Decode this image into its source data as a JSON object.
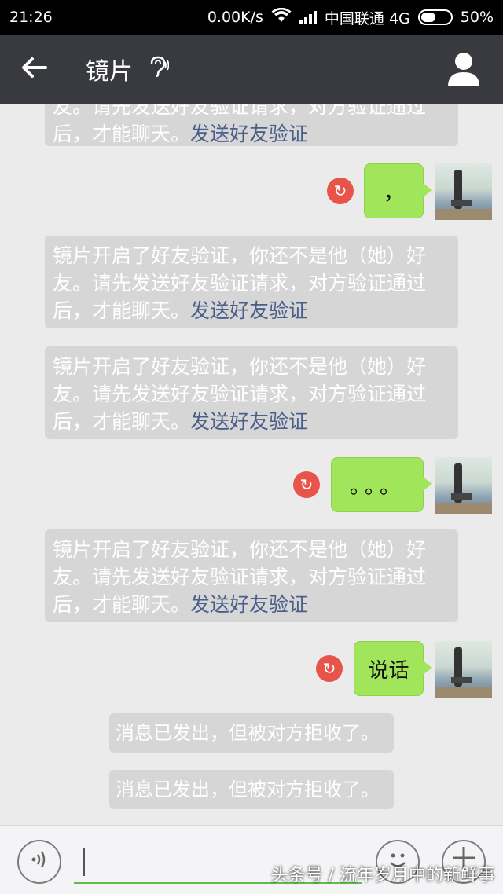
{
  "status_bar": {
    "time": "21:26",
    "speed": "0.00K/s",
    "carrier": "中国联通 4G",
    "battery": "50%",
    "battery_level": 0.5
  },
  "header": {
    "title": "镜片",
    "back_icon": "arrow-left-icon",
    "ear_icon": "ear-icon",
    "user_icon": "user-icon"
  },
  "messages": {
    "sys1": {
      "text": "友。请先发送好友验证请求，对方验证通过后，才能聊天。",
      "link": "发送好友验证"
    },
    "out1": {
      "text": "，"
    },
    "sys2": {
      "text": "镜片开启了好友验证，你还不是他（她）好友。请先发送好友验证请求，对方验证通过后，才能聊天。",
      "link": "发送好友验证"
    },
    "sys3": {
      "text": "镜片开启了好友验证，你还不是他（她）好友。请先发送好友验证请求，对方验证通过后，才能聊天。",
      "link": "发送好友验证"
    },
    "out2": {
      "text": "。。。"
    },
    "sys4": {
      "text": "镜片开启了好友验证，你还不是他（她）好友。请先发送好友验证请求，对方验证通过后，才能聊天。",
      "link": "发送好友验证"
    },
    "out3": {
      "text": "说话"
    },
    "rej1": {
      "text": "消息已发出，但被对方拒收了。"
    },
    "rej2": {
      "text": "消息已发出，但被对方拒收了。"
    }
  },
  "input_bar": {
    "voice_icon": "voice-icon",
    "emoji_icon": "emoji-icon",
    "plus_icon": "plus-icon",
    "value": ""
  },
  "watermark": "头条号 / 流年岁月中的新鲜事",
  "colors": {
    "header_bg": "#393a3f",
    "bubble_green": "#a1e55a",
    "resend_red": "#e8534a",
    "link_blue": "#4a5e8a"
  }
}
